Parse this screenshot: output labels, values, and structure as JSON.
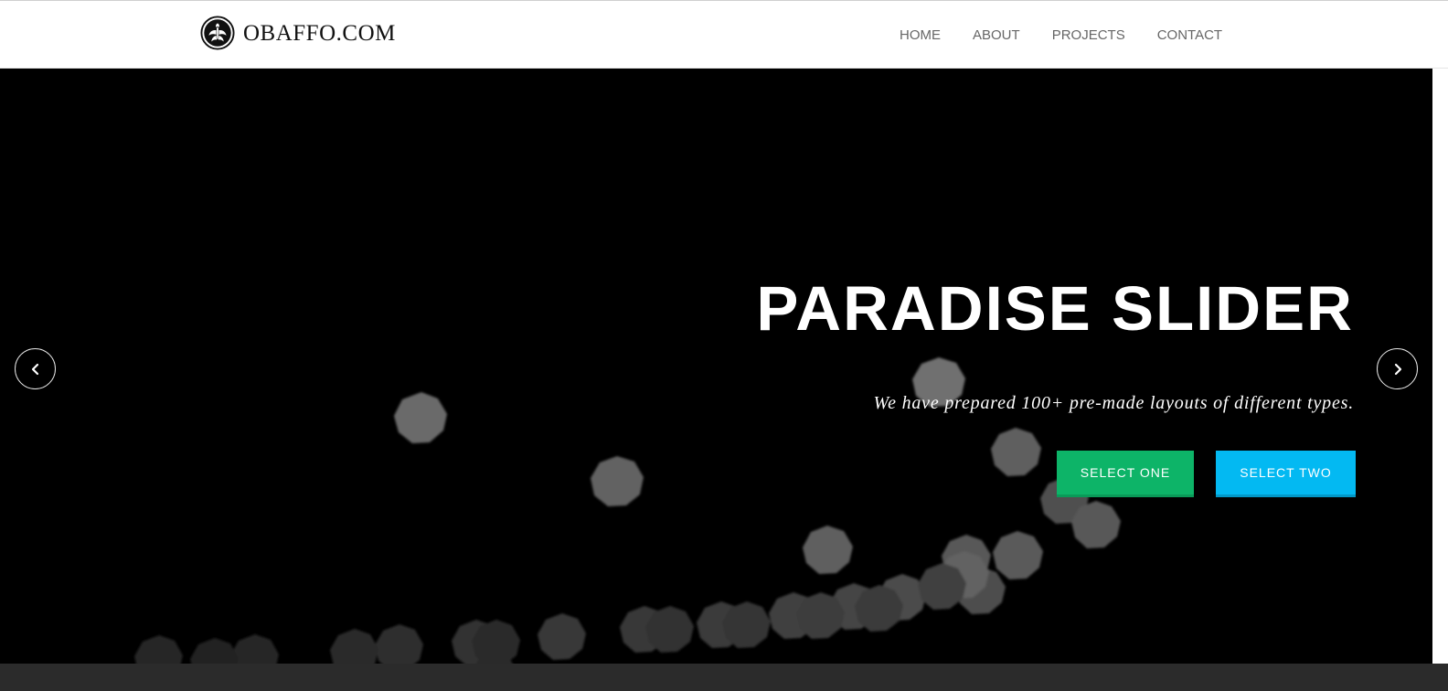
{
  "header": {
    "logo_text": "OBAFFO.COM",
    "logo_icon": "phoenix-emblem-icon",
    "nav": [
      {
        "label": "HOME"
      },
      {
        "label": "ABOUT"
      },
      {
        "label": "PROJECTS"
      },
      {
        "label": "CONTACT"
      }
    ]
  },
  "slider": {
    "title": "PARADISE SLIDER",
    "subtitle": "We have prepared 100+ pre-made layouts of different types.",
    "buttons": {
      "one": {
        "label": "SELECT ONE",
        "color": "#0db468"
      },
      "two": {
        "label": "SELECT TWO",
        "color": "#03b9f2"
      }
    },
    "prev_icon": "chevron-left-icon",
    "next_icon": "chevron-right-icon",
    "background_color": "#000000"
  }
}
